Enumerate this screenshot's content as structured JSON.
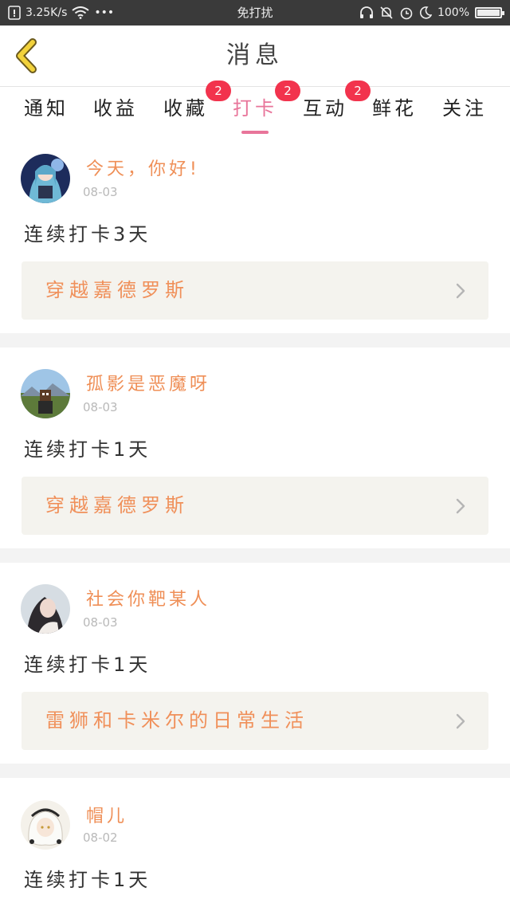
{
  "status_bar": {
    "net_speed": "3.25K/s",
    "dots": "•••",
    "center_title": "免打扰",
    "battery": "100%",
    "battery_level": 1.0
  },
  "header": {
    "title": "消息"
  },
  "tabs": [
    {
      "label": "通知",
      "badge": ""
    },
    {
      "label": "收益",
      "badge": ""
    },
    {
      "label": "收藏",
      "badge": "2"
    },
    {
      "label": "打卡",
      "badge": "2",
      "active": true
    },
    {
      "label": "互动",
      "badge": "2"
    },
    {
      "label": "鲜花",
      "badge": ""
    },
    {
      "label": "关注",
      "badge": ""
    }
  ],
  "feed": [
    {
      "username": "今天，你好!",
      "date": "08-03",
      "text": "连续打卡3天",
      "book": "穿越嘉德罗斯"
    },
    {
      "username": "孤影是恶魔呀",
      "date": "08-03",
      "text": "连续打卡1天",
      "book": "穿越嘉德罗斯"
    },
    {
      "username": "社会你靶某人",
      "date": "08-03",
      "text": "连续打卡1天",
      "book": "雷狮和卡米尔的日常生活"
    },
    {
      "username": "帽儿",
      "date": "08-02",
      "text": "连续打卡1天",
      "book": ""
    }
  ],
  "colors": {
    "accent": "#e8759a",
    "badge": "#f2334d",
    "username": "#ef8f57",
    "book_title": "#f0905a",
    "back_arrow": "#f2d23b"
  }
}
